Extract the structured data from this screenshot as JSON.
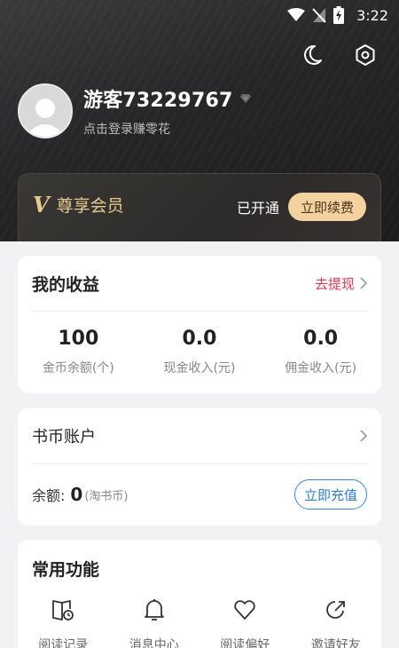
{
  "status_bar": {
    "time": "3:22"
  },
  "profile": {
    "username": "游客73229767",
    "login_hint": "点击登录赚零花"
  },
  "vip": {
    "logo": "V",
    "title": "尊享会员",
    "status": "已开通",
    "renew_label": "立即续费"
  },
  "earnings": {
    "title": "我的收益",
    "withdraw_label": "去提现",
    "stats": [
      {
        "value": "100",
        "label": "金币余额(个)"
      },
      {
        "value": "0.0",
        "label": "现金收入(元)"
      },
      {
        "value": "0.0",
        "label": "佣金收入(元)"
      }
    ]
  },
  "coins": {
    "title": "书币账户",
    "balance_label": "余额:",
    "balance_value": "0",
    "balance_unit": "(淘书币)",
    "recharge_label": "立即充值"
  },
  "functions": {
    "title": "常用功能",
    "items": [
      {
        "label": "阅读记录",
        "icon": "reading-history-icon"
      },
      {
        "label": "消息中心",
        "icon": "bell-icon"
      },
      {
        "label": "阅读偏好",
        "icon": "heart-icon"
      },
      {
        "label": "邀请好友",
        "icon": "share-icon"
      }
    ]
  },
  "colors": {
    "accent_red": "#e8384f",
    "accent_blue": "#2f7cd3",
    "vip_gold": "#e7c98f",
    "renew_button": "#f3d2a0"
  }
}
